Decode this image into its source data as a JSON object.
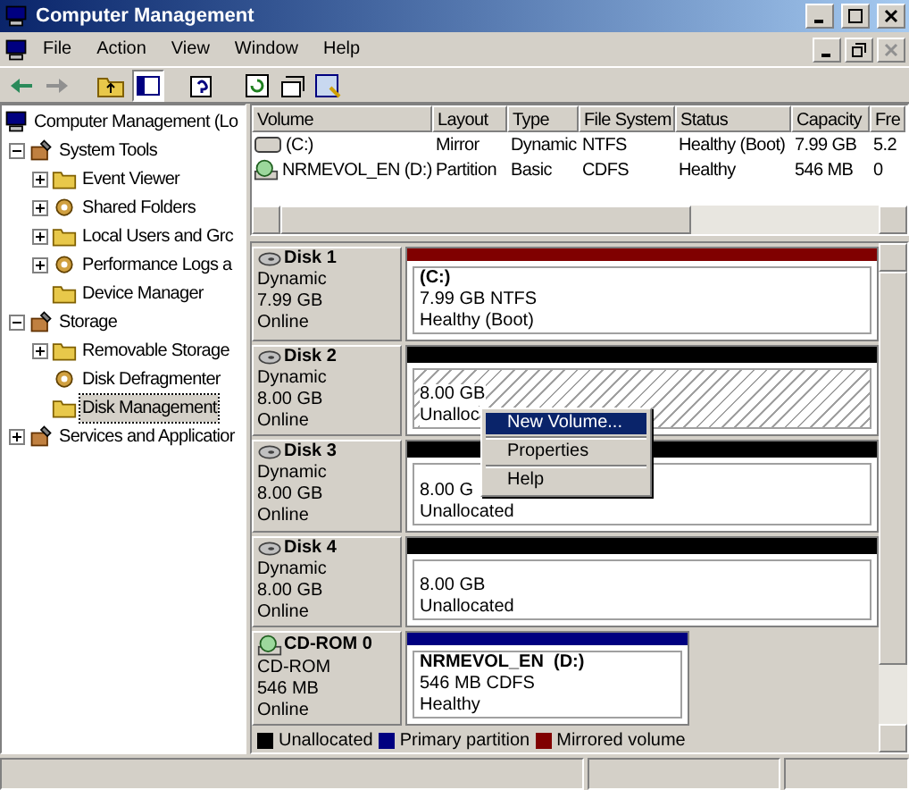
{
  "window": {
    "title": "Computer Management"
  },
  "menu": [
    "File",
    "Action",
    "View",
    "Window",
    "Help"
  ],
  "tree": [
    {
      "label": "Computer Management (Lo",
      "selected": false,
      "children": [
        {
          "label": "System Tools",
          "expanded": true,
          "selected": false,
          "children": [
            {
              "label": "Event Viewer",
              "expanded": false,
              "selected": false
            },
            {
              "label": "Shared Folders",
              "expanded": false,
              "selected": false
            },
            {
              "label": "Local Users and Grc",
              "expanded": false,
              "selected": false
            },
            {
              "label": "Performance Logs a",
              "expanded": false,
              "selected": false
            },
            {
              "label": "Device Manager",
              "selected": false
            }
          ]
        },
        {
          "label": "Storage",
          "expanded": true,
          "selected": false,
          "children": [
            {
              "label": "Removable Storage",
              "expanded": false,
              "selected": false
            },
            {
              "label": "Disk Defragmenter",
              "selected": false
            },
            {
              "label": "Disk Management",
              "selected": true
            }
          ]
        },
        {
          "label": "Services and Applicatior",
          "expanded": false,
          "selected": false
        }
      ]
    }
  ],
  "volumes": {
    "columns": [
      "Volume",
      "Layout",
      "Type",
      "File System",
      "Status",
      "Capacity",
      "Fre"
    ],
    "rows": [
      {
        "kind": "disk",
        "cells": [
          "(C:)",
          "Mirror",
          "Dynamic",
          "NTFS",
          "Healthy (Boot)",
          "7.99 GB",
          "5.2"
        ]
      },
      {
        "kind": "cdrom",
        "cells": [
          "NRMEVOL_EN (D:)",
          "Partition",
          "Basic",
          "CDFS",
          "Healthy",
          "546 MB",
          "0"
        ]
      }
    ]
  },
  "disks": [
    {
      "kind": "disk",
      "name": "Disk 1",
      "lines": [
        "Dynamic",
        "7.99 GB",
        "Online"
      ],
      "partition": {
        "color": "#800000",
        "selected": false,
        "title": "(C:)",
        "lines": [
          "7.99 GB NTFS",
          "Healthy (Boot)"
        ]
      }
    },
    {
      "kind": "disk",
      "name": "Disk 2",
      "lines": [
        "Dynamic",
        "8.00 GB",
        "Online"
      ],
      "partition": {
        "color": "#000000",
        "selected": true,
        "lines": [
          "8.00 GB",
          "Unalloc"
        ]
      }
    },
    {
      "kind": "disk",
      "name": "Disk 3",
      "lines": [
        "Dynamic",
        "8.00 GB",
        "Online"
      ],
      "partition": {
        "color": "#000000",
        "selected": false,
        "lines": [
          "8.00 G",
          "Unallocated"
        ]
      }
    },
    {
      "kind": "disk",
      "name": "Disk 4",
      "lines": [
        "Dynamic",
        "8.00 GB",
        "Online"
      ],
      "partition": {
        "color": "#000000",
        "selected": false,
        "lines": [
          "8.00 GB",
          "Unallocated"
        ]
      }
    },
    {
      "kind": "cdrom",
      "name": "CD-ROM 0",
      "lines": [
        "CD-ROM",
        "546 MB",
        "Online"
      ],
      "partition": {
        "color": "#000080",
        "selected": false,
        "title": "NRMEVOL_EN  (D:)",
        "lines": [
          "546 MB CDFS",
          "Healthy"
        ]
      }
    }
  ],
  "context_menu": [
    {
      "label": "New Volume...",
      "selected": true
    },
    {
      "label": "Properties",
      "selected": false
    },
    {
      "label": "Help",
      "selected": false
    }
  ],
  "legend": [
    {
      "label": "Unallocated",
      "color": "#000000"
    },
    {
      "label": "Primary partition",
      "color": "#000080"
    },
    {
      "label": "Mirrored volume",
      "color": "#800000"
    }
  ]
}
